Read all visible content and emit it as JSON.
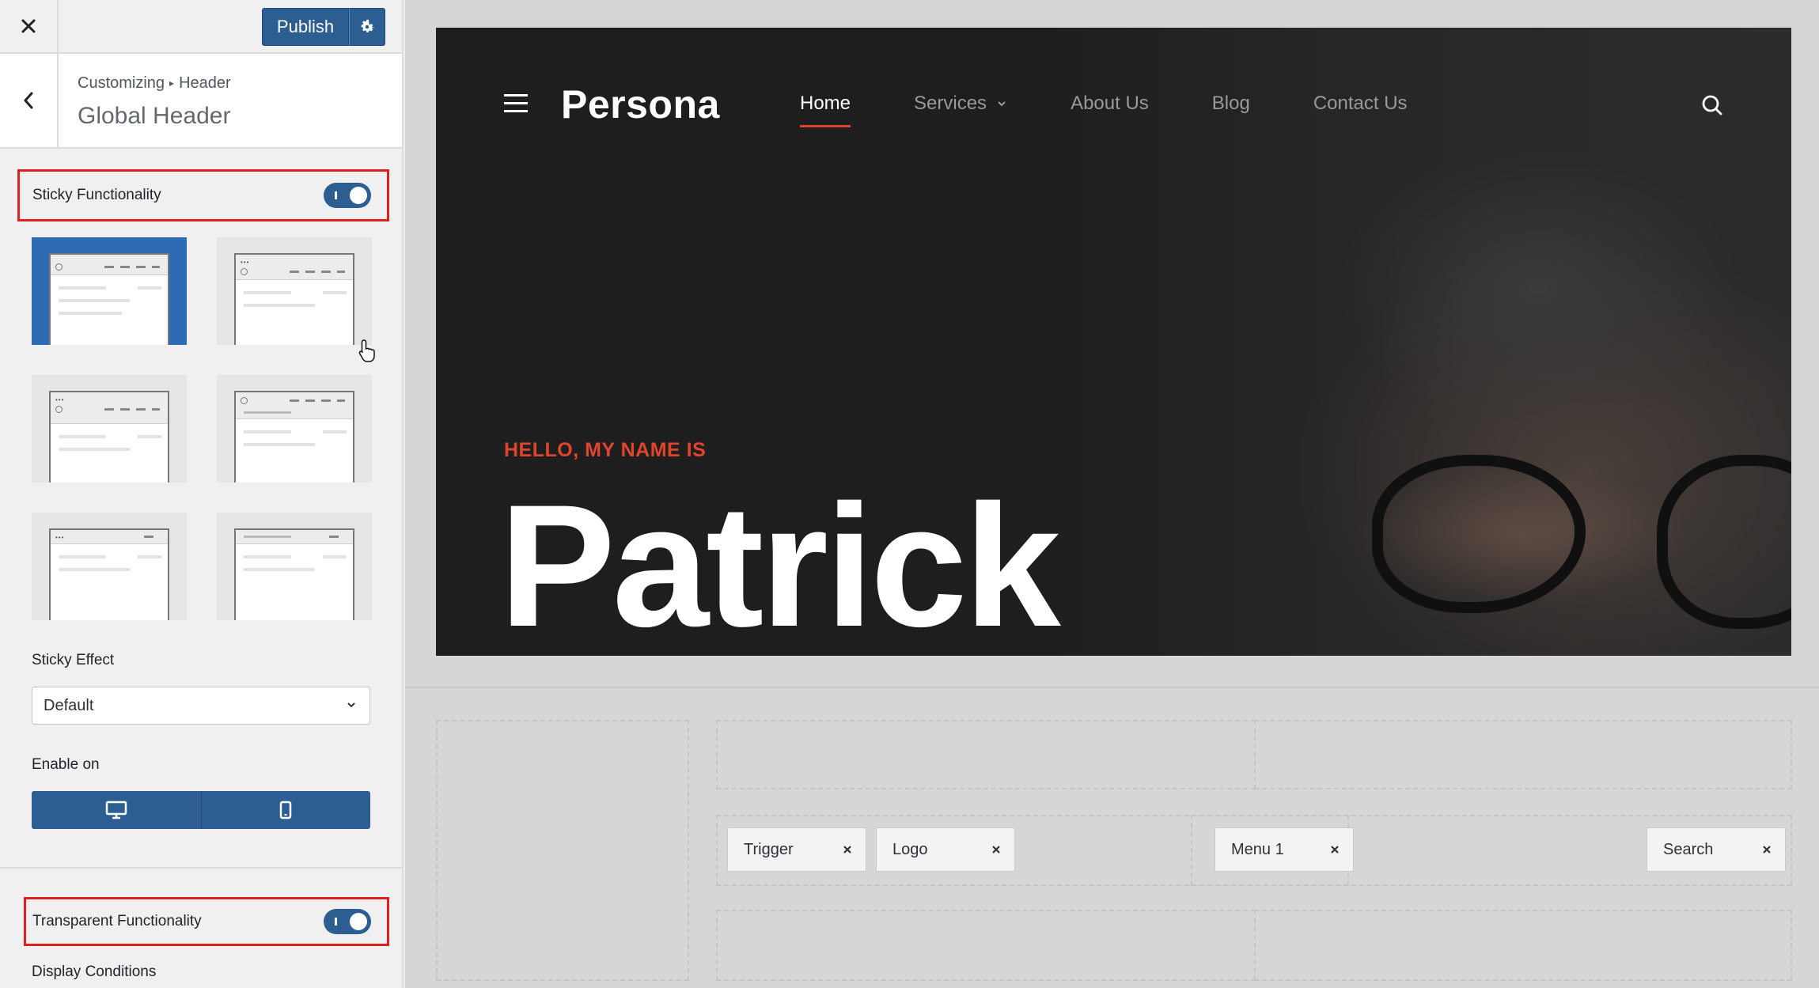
{
  "sidebar": {
    "publish_label": "Publish",
    "breadcrumb": [
      "Customizing",
      "Header"
    ],
    "section_title": "Global Header",
    "sticky": {
      "label": "Sticky Functionality",
      "enabled": true
    },
    "layouts": [
      {
        "active": true
      },
      {
        "active": false
      },
      {
        "active": false
      },
      {
        "active": false
      },
      {
        "active": false
      },
      {
        "active": false
      }
    ],
    "sticky_effect": {
      "label": "Sticky Effect",
      "value": "Default"
    },
    "enable_on": {
      "label": "Enable on",
      "devices": [
        "desktop-icon",
        "mobile-icon"
      ]
    },
    "transparent": {
      "label": "Transparent Functionality",
      "enabled": true
    },
    "display_conditions_label": "Display Conditions"
  },
  "preview": {
    "brand": "Persona",
    "nav": [
      {
        "label": "Home",
        "active": true
      },
      {
        "label": "Services",
        "active": false,
        "has_submenu": true
      },
      {
        "label": "About Us",
        "active": false
      },
      {
        "label": "Blog",
        "active": false
      },
      {
        "label": "Contact Us",
        "active": false
      }
    ],
    "eyebrow": "HELLO, MY NAME IS",
    "name": "Patrick",
    "builder_items": [
      "Trigger",
      "Logo",
      "Menu 1",
      "Search"
    ]
  },
  "colors": {
    "accent_blue": "#2c5e92",
    "accent_red": "#e0452b",
    "highlight": "#e02020",
    "hero_bg": "#1e1e1e"
  }
}
